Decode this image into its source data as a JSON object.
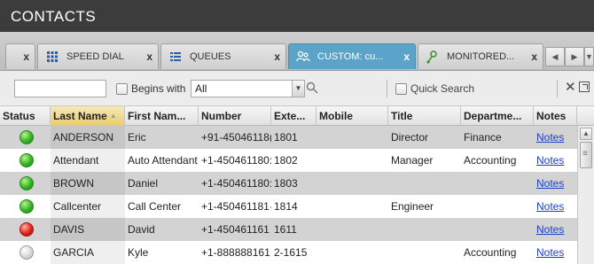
{
  "header": {
    "title": "CONTACTS"
  },
  "tabs": [
    {
      "label": "",
      "close": "x",
      "icon": "",
      "active": false
    },
    {
      "label": "SPEED DIAL",
      "close": "x",
      "icon": "grid-icon",
      "active": false
    },
    {
      "label": "QUEUES",
      "close": "x",
      "icon": "list-icon",
      "active": false
    },
    {
      "label": "CUSTOM: cu...",
      "close": "x",
      "icon": "people-icon",
      "active": true
    },
    {
      "label": "MONITORED...",
      "close": "x",
      "icon": "monitored-icon",
      "active": false
    }
  ],
  "tab_scroll": {
    "left": "◀",
    "right": "▶",
    "menu": "▼"
  },
  "filter": {
    "search_value": "",
    "begins_with_label": "Begins with",
    "begins_with_checked": false,
    "select_value": "All",
    "quick_search_label": "Quick Search",
    "quick_search_checked": false,
    "clear_glyph": "✕"
  },
  "table": {
    "columns": [
      "Status",
      "Last Name",
      "First Nam...",
      "Number",
      "Exte...",
      "Mobile",
      "Title",
      "Departme...",
      "Notes"
    ],
    "sorted_column": "Last Name",
    "sort_glyph": "▲",
    "rows": [
      {
        "status": "available",
        "last": "ANDERSON",
        "first": "Eric",
        "number": "+91-45046118(",
        "ext": "1801",
        "mobile": "",
        "title": "Director",
        "dept": "Finance",
        "notes": "Notes"
      },
      {
        "status": "available",
        "last": "Attendant",
        "first": "Auto Attendant",
        "number": "+1-450461180:",
        "ext": "1802",
        "mobile": "",
        "title": "Manager",
        "dept": "Accounting",
        "notes": "Notes"
      },
      {
        "status": "available",
        "last": "BROWN",
        "first": "Daniel",
        "number": "+1-450461180:",
        "ext": "1803",
        "mobile": "",
        "title": "",
        "dept": "",
        "notes": "Notes"
      },
      {
        "status": "available",
        "last": "Callcenter",
        "first": "Call Center",
        "number": "+1-450461181·",
        "ext": "1814",
        "mobile": "",
        "title": "Engineer",
        "dept": "",
        "notes": "Notes"
      },
      {
        "status": "busy",
        "last": "DAVIS",
        "first": "David",
        "number": "+1-450461161",
        "ext": "1611",
        "mobile": "",
        "title": "",
        "dept": "",
        "notes": "Notes"
      },
      {
        "status": "offline",
        "last": "GARCIA",
        "first": "Kyle",
        "number": "+1-888888161",
        "ext": "2-1615",
        "mobile": "",
        "title": "",
        "dept": "Accounting",
        "notes": "Notes"
      }
    ]
  },
  "colors": {
    "title_bar": "#3c3c3c",
    "active_tab": "#5ba3c9",
    "row_alt": "#d3d3d3",
    "link": "#1a3fc9",
    "available": "#33b423",
    "busy": "#e0241a",
    "offline": "#d6d6d6"
  }
}
